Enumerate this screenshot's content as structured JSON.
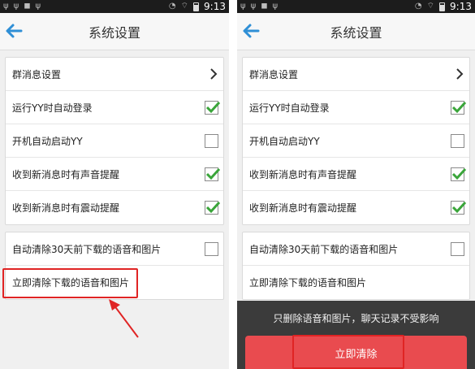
{
  "status_bar": {
    "time": "9:13"
  },
  "header": {
    "title": "系统设置"
  },
  "settings_group_1": [
    {
      "label": "群消息设置",
      "control": "chevron"
    },
    {
      "label": "运行YY时自动登录",
      "control": "checkbox",
      "checked": true
    },
    {
      "label": "开机自动启动YY",
      "control": "checkbox",
      "checked": false
    },
    {
      "label": "收到新消息时有声音提醒",
      "control": "checkbox",
      "checked": true
    },
    {
      "label": "收到新消息时有震动提醒",
      "control": "checkbox",
      "checked": true
    }
  ],
  "settings_group_2": [
    {
      "label": "自动清除30天前下载的语音和图片",
      "control": "checkbox",
      "checked": false
    },
    {
      "label": "立即清除下载的语音和图片",
      "control": "none"
    }
  ],
  "dialog": {
    "message": "只删除语音和图片，聊天记录不受影响",
    "confirm_label": "立即清除"
  },
  "colors": {
    "check_green": "#3aa53a",
    "back_arrow_blue": "#2f8fd6",
    "highlight_red": "#e02424",
    "confirm_button": "#e94b4f",
    "sheet_background": "#3b3b3b"
  }
}
